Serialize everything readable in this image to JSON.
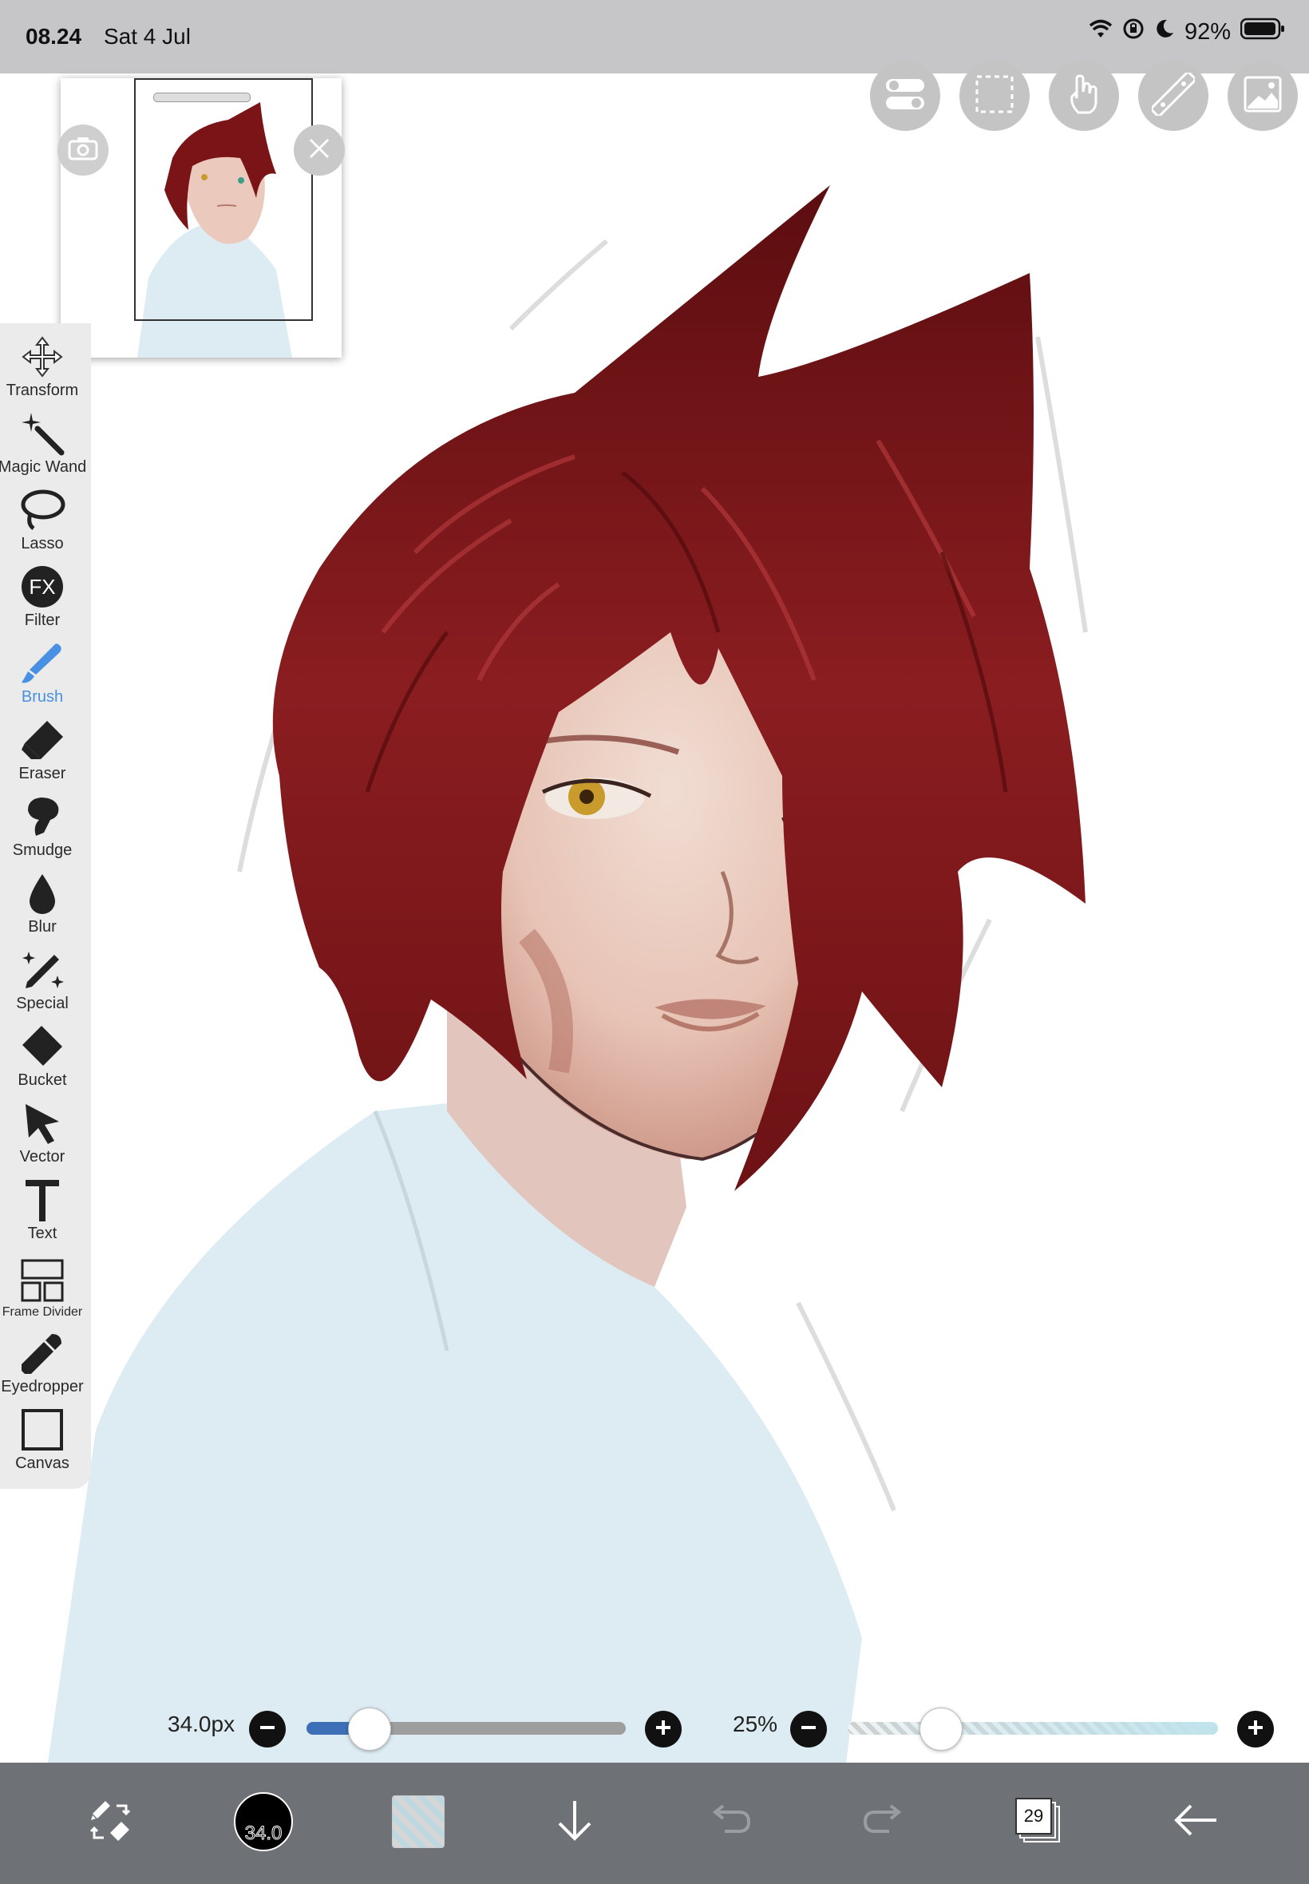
{
  "status_bar": {
    "time": "08.24",
    "date": "Sat 4 Jul",
    "battery": "92%",
    "icons": [
      "wifi-icon",
      "orientation-lock-icon",
      "moon-icon",
      "battery-icon"
    ]
  },
  "top_buttons": [
    {
      "name": "toggle-settings-button",
      "icon": "toggle-icon"
    },
    {
      "name": "selection-button",
      "icon": "dashed-selection-icon"
    },
    {
      "name": "gesture-button",
      "icon": "hand-icon"
    },
    {
      "name": "ruler-button",
      "icon": "ruler-icon"
    },
    {
      "name": "material-button",
      "icon": "image-icon"
    }
  ],
  "navigator": {
    "camera_icon": "camera-icon",
    "close_icon": "close-icon"
  },
  "tools": [
    {
      "label": "Transform",
      "icon": "move-arrows-icon"
    },
    {
      "label": "Magic Wand",
      "icon": "magic-wand-icon"
    },
    {
      "label": "Lasso",
      "icon": "lasso-icon"
    },
    {
      "label": "Filter",
      "icon": "fx-icon"
    },
    {
      "label": "Brush",
      "icon": "brush-icon",
      "active": true
    },
    {
      "label": "Eraser",
      "icon": "eraser-icon"
    },
    {
      "label": "Smudge",
      "icon": "smudge-icon"
    },
    {
      "label": "Blur",
      "icon": "drop-icon"
    },
    {
      "label": "Special",
      "icon": "sparkle-pen-icon"
    },
    {
      "label": "Bucket",
      "icon": "bucket-icon"
    },
    {
      "label": "Vector",
      "icon": "cursor-arrow-icon"
    },
    {
      "label": "Text",
      "icon": "text-icon"
    },
    {
      "label": "Frame Divider",
      "icon": "frame-divider-icon"
    },
    {
      "label": "Eyedropper",
      "icon": "eyedropper-icon"
    },
    {
      "label": "Canvas",
      "icon": "canvas-icon"
    }
  ],
  "brush_size": {
    "label": "34.0px",
    "value": 34.0,
    "fraction": 0.17
  },
  "opacity": {
    "label": "25%",
    "value": 25,
    "fraction": 0.25
  },
  "bottom_bar": {
    "color_button_label": "34.0",
    "layers_count": "29"
  },
  "colors": {
    "active_tool": "#4a90e2",
    "slider_fill": "#3d6fb6",
    "toolbar_bg": "#ebebeb",
    "bottom_bar_bg": "#6e7276",
    "hair": "#7a1416",
    "shirt": "#dcecf2"
  }
}
